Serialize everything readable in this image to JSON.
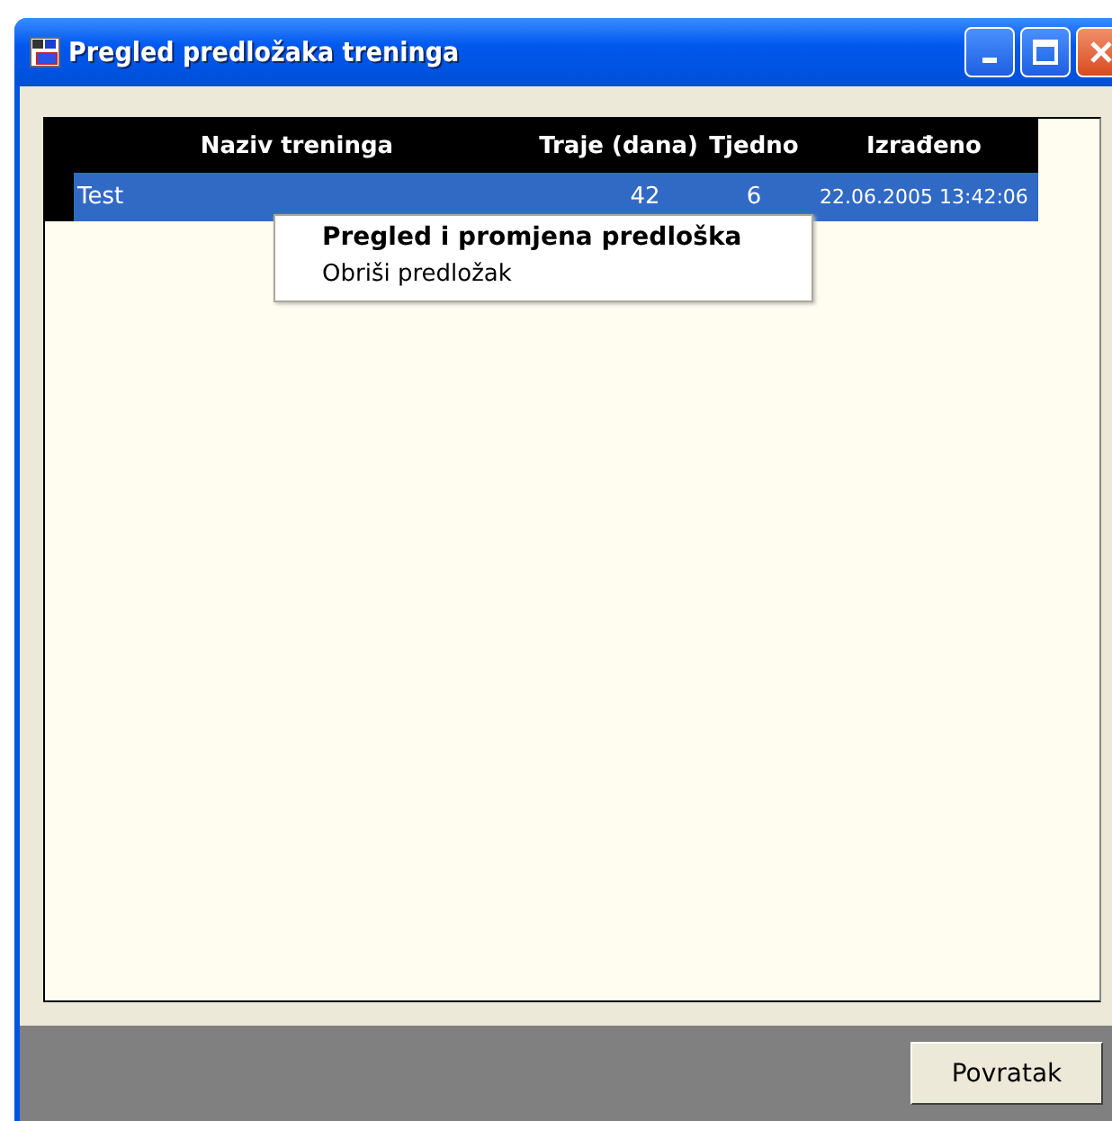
{
  "window": {
    "title": "Pregled predložaka treninga"
  },
  "table": {
    "columns": [
      "Naziv treninga",
      "Traje (dana)",
      "Tjedno",
      "Izrađeno"
    ],
    "rows": [
      {
        "cells": [
          "Test",
          "42",
          "6",
          "22.06.2005 13:42:06"
        ],
        "selected": true
      }
    ]
  },
  "context_menu": {
    "items": [
      {
        "label": "Pregled i promjena predloška",
        "default": true
      },
      {
        "label": "Obriši predložak",
        "default": false
      }
    ]
  },
  "buttons": [
    "Povratak"
  ]
}
